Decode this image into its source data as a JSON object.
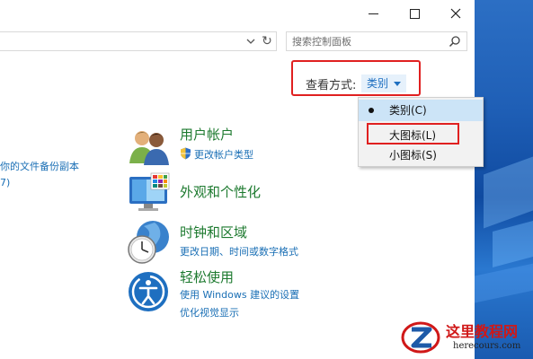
{
  "window": {
    "minimize_icon": "minimize-icon",
    "maximize_icon": "maximize-icon",
    "close_icon": "close-icon"
  },
  "address": {
    "refresh_icon": "↻"
  },
  "search": {
    "placeholder": "搜索控制面板"
  },
  "view_by": {
    "label": "查看方式:",
    "value": "类别"
  },
  "menu": {
    "items": [
      {
        "label": "类别(C)",
        "selected": true
      },
      {
        "label": "大图标(L)",
        "selected": false
      },
      {
        "label": "小图标(S)",
        "selected": false
      }
    ]
  },
  "left_partial": {
    "line1": "你的文件备份副本",
    "line2": "7)"
  },
  "categories": [
    {
      "title": "用户帐户",
      "links": [
        "更改帐户类型"
      ]
    },
    {
      "title": "外观和个性化",
      "links": []
    },
    {
      "title": "时钟和区域",
      "links": [
        "更改日期、时间或数字格式"
      ]
    },
    {
      "title": "轻松使用",
      "links": [
        "使用 Windows 建议的设置",
        "优化视觉显示"
      ]
    }
  ],
  "watermark": {
    "title": "这里教程网",
    "sub": "herecours.com"
  },
  "colors": {
    "link": "#1a6fb5",
    "category_title": "#1d7a2f",
    "highlight": "#e02020"
  }
}
